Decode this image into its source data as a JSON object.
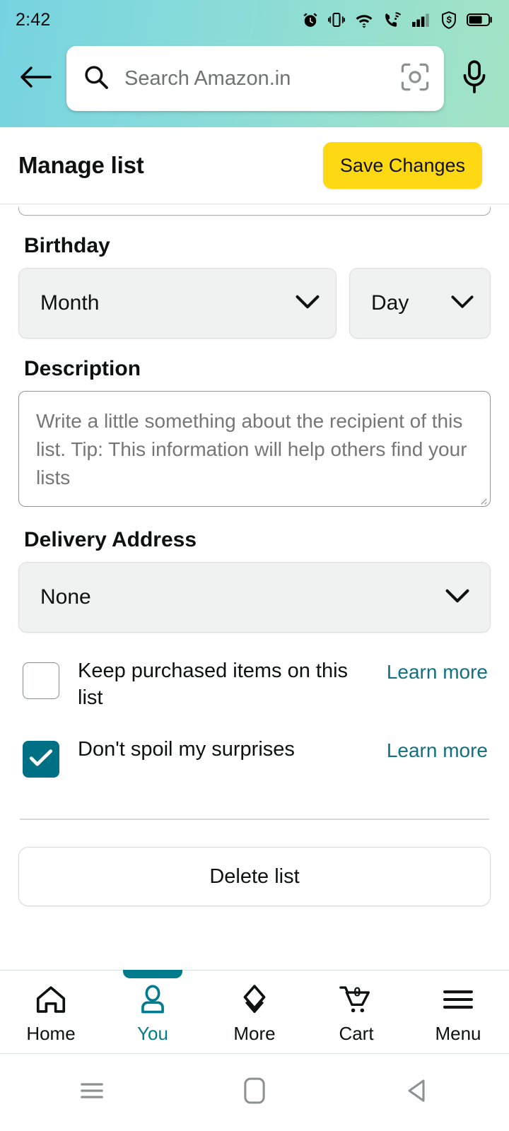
{
  "statusbar": {
    "time": "2:42",
    "icons": [
      "alarm-icon",
      "vibrate-icon",
      "wifi-icon",
      "wifi-calling-icon",
      "signal-bars-icon",
      "shield-dollar-icon",
      "battery-icon"
    ]
  },
  "header": {
    "back_icon": "back-arrow-icon",
    "search_placeholder": "Search Amazon.in",
    "search_icon": "search-icon",
    "lens_icon": "camera-lens-icon",
    "mic_icon": "microphone-icon",
    "gradient_start": "#76d3e0",
    "gradient_end": "#a3e3c4"
  },
  "titlebar": {
    "title": "Manage list",
    "save_label": "Save Changes",
    "save_color": "#ffd814"
  },
  "form": {
    "birthday": {
      "label": "Birthday",
      "month_value": "Month",
      "day_value": "Day",
      "chevron_icon": "chevron-down-icon"
    },
    "description": {
      "label": "Description",
      "placeholder": "Write a little something about the recipient of this list. Tip: This information will help others find your lists",
      "value": ""
    },
    "delivery_address": {
      "label": "Delivery Address",
      "value": "None",
      "chevron_icon": "chevron-down-icon"
    },
    "options": [
      {
        "label": "Keep purchased items on this list",
        "checked": false,
        "link_label": "Learn more"
      },
      {
        "label": "Don't spoil my surprises",
        "checked": true,
        "link_label": "Learn more"
      }
    ],
    "checkbox_accent": "#007185",
    "link_color": "#117180",
    "delete_label": "Delete list"
  },
  "bottomnav": {
    "active_color": "#007c8c",
    "cart_count": "0",
    "items": [
      {
        "label": "Home",
        "icon": "home-icon",
        "active": false
      },
      {
        "label": "You",
        "icon": "person-icon",
        "active": true
      },
      {
        "label": "More",
        "icon": "chevrons-down-icon",
        "active": false
      },
      {
        "label": "Cart",
        "icon": "cart-icon",
        "active": false
      },
      {
        "label": "Menu",
        "icon": "hamburger-icon",
        "active": false
      }
    ]
  },
  "sysnav": {
    "buttons": [
      {
        "name": "recents-icon"
      },
      {
        "name": "home-square-icon"
      },
      {
        "name": "back-triangle-icon"
      }
    ]
  }
}
